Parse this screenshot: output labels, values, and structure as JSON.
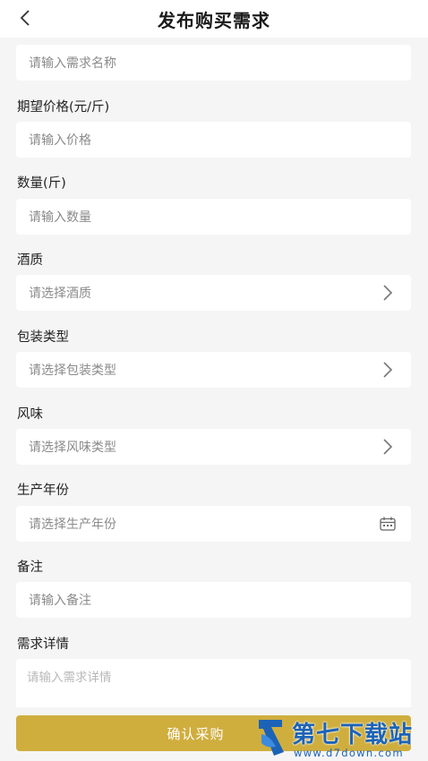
{
  "header": {
    "title": "发布购买需求",
    "back_icon": "chevron-left-icon"
  },
  "form": {
    "name": {
      "placeholder": "请输入需求名称"
    },
    "price": {
      "label": "期望价格(元/斤)",
      "placeholder": "请输入价格"
    },
    "quantity": {
      "label": "数量(斤)",
      "placeholder": "请输入数量"
    },
    "quality": {
      "label": "酒质",
      "placeholder": "请选择酒质",
      "icon": "chevron-right-icon"
    },
    "packaging": {
      "label": "包装类型",
      "placeholder": "请选择包装类型",
      "icon": "chevron-right-icon"
    },
    "flavor": {
      "label": "风味",
      "placeholder": "请选择风味类型",
      "icon": "chevron-right-icon"
    },
    "year": {
      "label": "生产年份",
      "placeholder": "请选择生产年份",
      "icon": "calendar-icon"
    },
    "remark": {
      "label": "备注",
      "placeholder": "请输入备注"
    },
    "detail": {
      "label": "需求详情",
      "placeholder": "请输入需求详情"
    }
  },
  "submit": {
    "label": "确认采购",
    "color": "#cfae3e"
  },
  "watermark": {
    "title": "第七下载站",
    "url": "www.d7down.com",
    "color": "#1c63b7"
  }
}
